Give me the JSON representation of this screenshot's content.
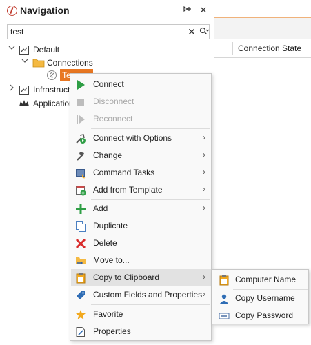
{
  "panel": {
    "title": "Navigation"
  },
  "search": {
    "value": "test"
  },
  "grid": {
    "column_header": "Connection State"
  },
  "tree": {
    "default": "Default",
    "connections": "Connections",
    "selected": "Te",
    "infrastructure": "Infrastructu",
    "applications": "Application"
  },
  "context_menu": {
    "connect": "Connect",
    "disconnect": "Disconnect",
    "reconnect": "Reconnect",
    "connect_with_options": "Connect with Options",
    "change": "Change",
    "command_tasks": "Command Tasks",
    "add_from_template": "Add from Template",
    "add": "Add",
    "duplicate": "Duplicate",
    "delete": "Delete",
    "move_to": "Move to...",
    "copy_to_clipboard": "Copy to Clipboard",
    "custom_fields": "Custom Fields and Properties",
    "favorite": "Favorite",
    "properties": "Properties"
  },
  "clipboard_submenu": {
    "computer_name": "Computer Name",
    "copy_username": "Copy  Username",
    "copy_password": "Copy  Password"
  },
  "colors": {
    "accent": "#e87722",
    "connect_green": "#2e9e45",
    "delete_red": "#d92b2b"
  }
}
